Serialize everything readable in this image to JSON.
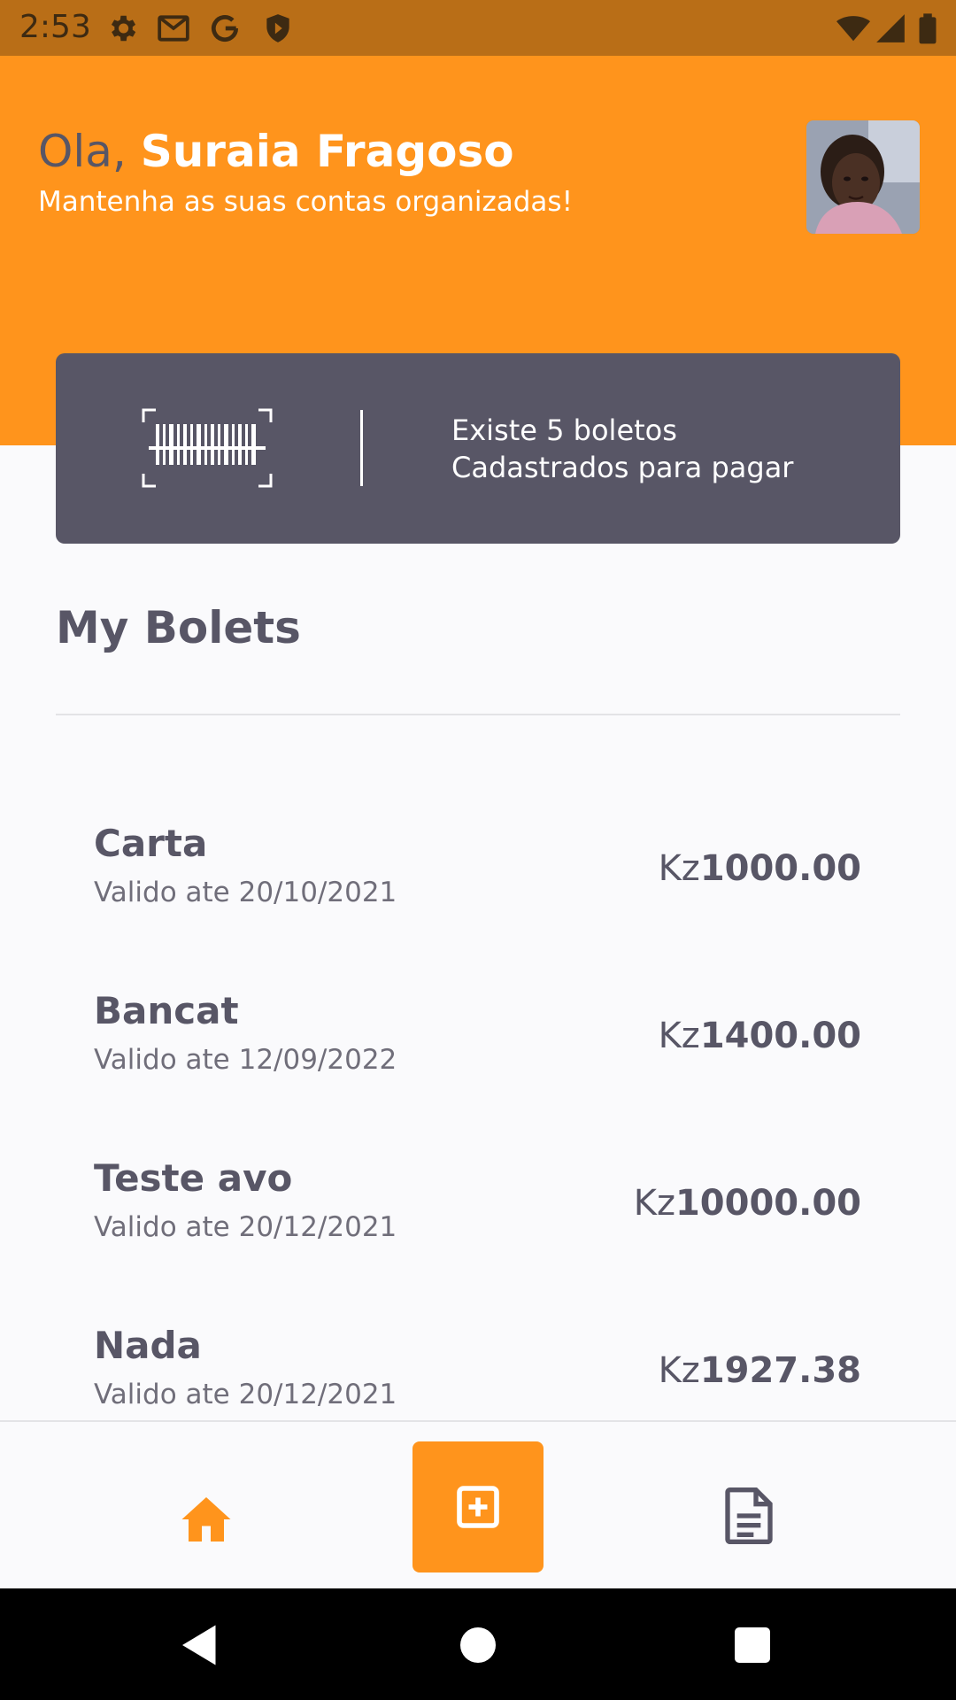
{
  "status_bar": {
    "time": "2:53",
    "left_icons": [
      "settings-icon",
      "gmail-icon",
      "google-icon",
      "shield-icon"
    ],
    "right_icons": [
      "wifi-icon",
      "signal-icon",
      "battery-icon"
    ]
  },
  "header": {
    "greeting_prefix": "Ola, ",
    "user_name": "Suraia Fragoso",
    "subtitle": "Mantenha as suas contas organizadas!",
    "avatar_icon": "user-avatar"
  },
  "summary_card": {
    "icon": "barcode-scan-icon",
    "line1": "Existe 5 boletos",
    "line2": "Cadastrados para pagar"
  },
  "section": {
    "title": "My Bolets"
  },
  "boletos": [
    {
      "name": "Carta",
      "valid_until": "Valido ate 20/10/2021",
      "currency": "Kz",
      "amount": "1000.00"
    },
    {
      "name": "Bancat",
      "valid_until": "Valido ate 12/09/2022",
      "currency": "Kz",
      "amount": "1400.00"
    },
    {
      "name": "Teste avo",
      "valid_until": "Valido ate 20/12/2021",
      "currency": "Kz",
      "amount": "10000.00"
    },
    {
      "name": "Nada",
      "valid_until": "Valido ate 20/12/2021",
      "currency": "Kz",
      "amount": "1927.38"
    }
  ],
  "bottom_nav": {
    "items": [
      "home-icon",
      "add-boleto-icon",
      "document-icon"
    ],
    "active": "home-icon"
  },
  "colors": {
    "primary": "#FF941C",
    "status_bar": "#B96E17",
    "card": "#585666",
    "heading": "#585666",
    "body_bg": "#FAFAFC"
  }
}
